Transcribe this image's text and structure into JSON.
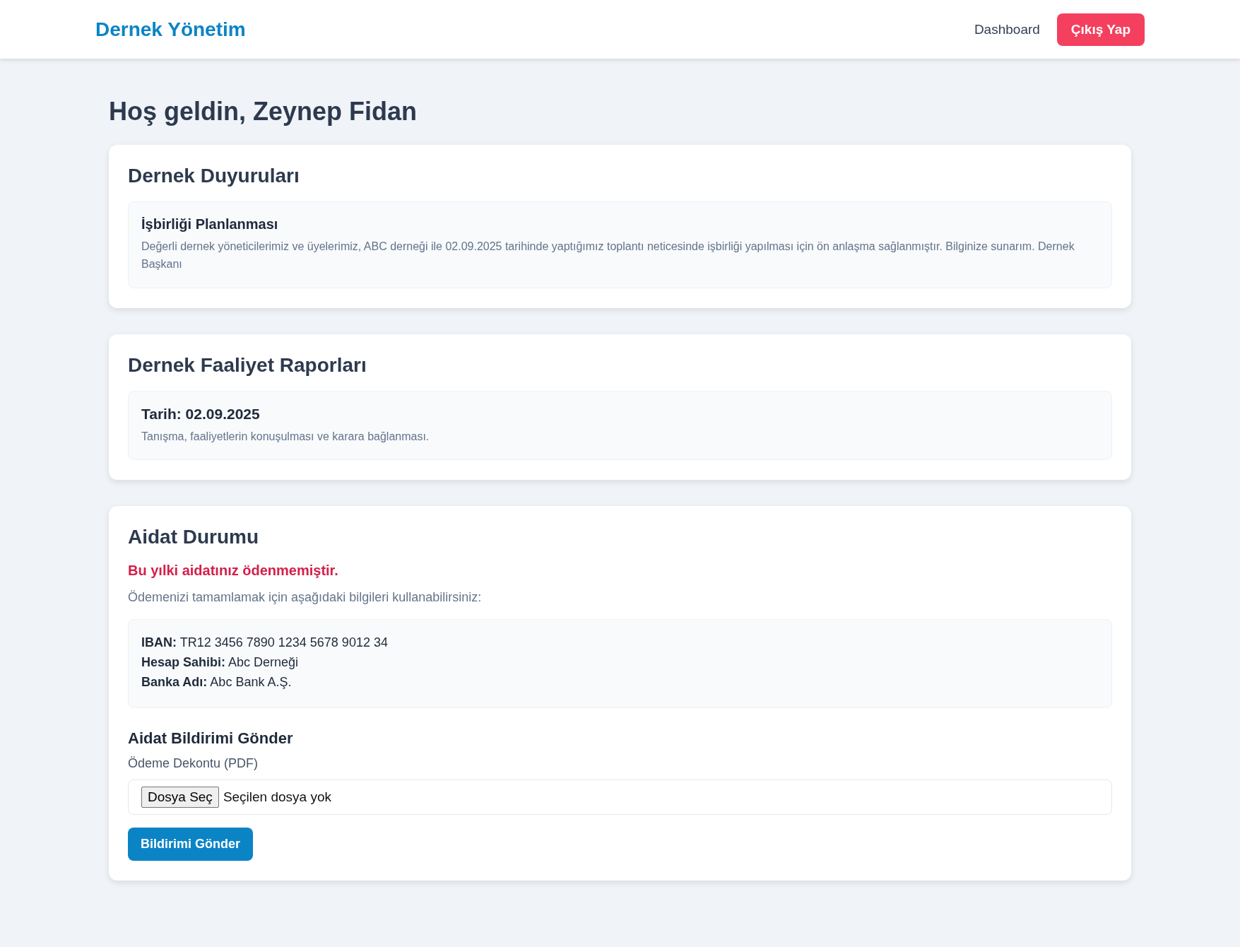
{
  "navbar": {
    "brand": "Dernek Yönetim",
    "links": [
      {
        "label": "Dashboard",
        "kind": "link"
      },
      {
        "label": "Çıkış Yap",
        "kind": "button"
      }
    ]
  },
  "greeting": "Hoş geldin, Zeynep Fidan",
  "announcements": {
    "title": "Dernek Duyuruları",
    "items": [
      {
        "title": "İşbirliği Planlanması",
        "body": "Değerli dernek yöneticilerimiz ve üyelerimiz, ABC derneği ile 02.09.2025 tarihinde yaptığımız toplantı neticesinde işbirliği yapılması için ön anlaşma sağlanmıştır. Bilginize sunarım. Dernek Başkanı"
      }
    ]
  },
  "reports": {
    "title": "Dernek Faaliyet Raporları",
    "items": [
      {
        "title": "Tarih: 02.09.2025",
        "body": "Tanışma, faaliyetlerin konuşulması ve karara bağlanması."
      }
    ]
  },
  "dues": {
    "title": "Aidat Durumu",
    "paid": false,
    "status_text": "Bu yılki aidatınız ödenmemiştir.",
    "instructions": "Ödemenizi tamamlamak için aşağıdaki bilgileri kullanabilirsiniz:",
    "bank_details": [
      "**IBAN:** TR12 3456 7890 1234 5678 9012 34",
      "**Hesap Sahibi:** Abc Derneği",
      "**Banka Adı:** Abc Bank A.Ş."
    ],
    "form": {
      "title": "Aidat Bildirimi Gönder",
      "field_label": "Ödeme Dekontu (PDF)",
      "choose_button": "Dosya Seç",
      "file_status": "Seçilen dosya yok",
      "submit": "Bildirimi Gönder"
    }
  }
}
